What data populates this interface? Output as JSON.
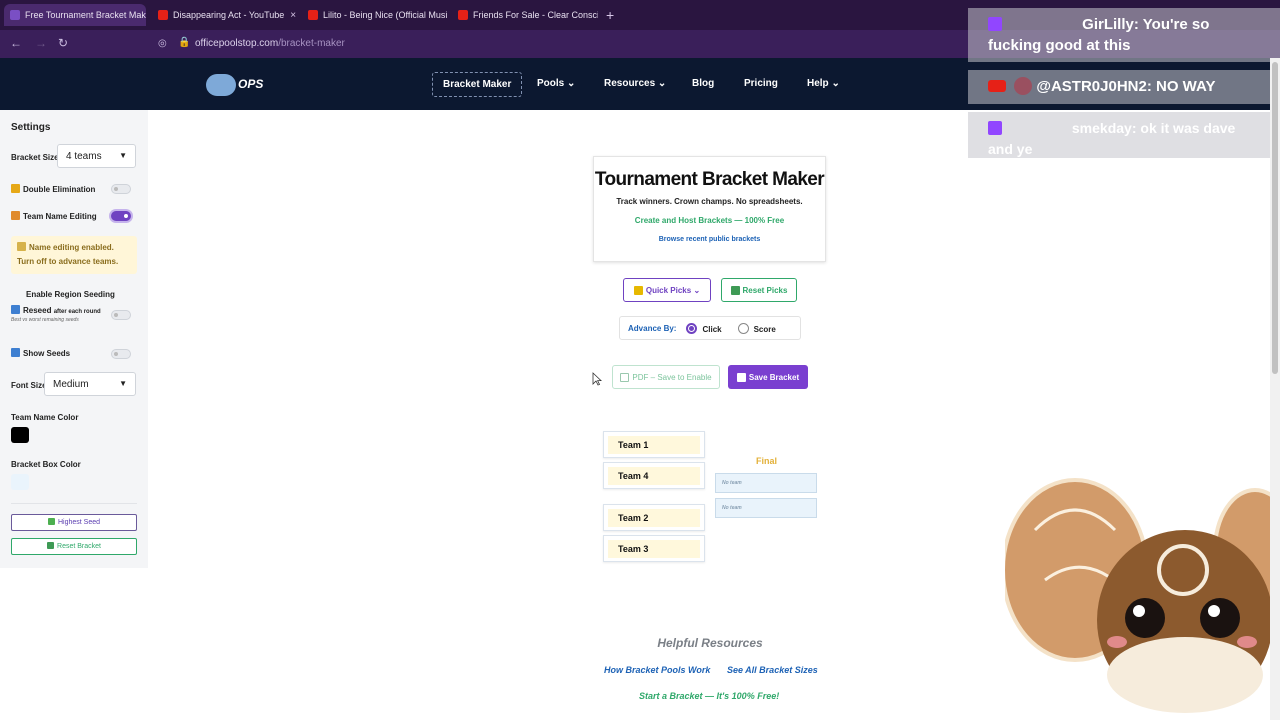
{
  "browser": {
    "tabs": [
      {
        "title": "Free Tournament Bracket Maker",
        "favicon_color": "#7a4fc4"
      },
      {
        "title": "Disappearing Act - YouTube",
        "favicon_color": "#e62117"
      },
      {
        "title": "Lilito - Being Nice (Official Musi",
        "favicon_color": "#e62117"
      },
      {
        "title": "Friends For Sale - Clear Conscie",
        "favicon_color": "#e62117"
      }
    ],
    "close_glyph": "×",
    "new_tab_glyph": "+",
    "url_domain": "officepoolstop.com",
    "url_path": "/bracket-maker"
  },
  "site": {
    "logo_text": "OPS",
    "nav": [
      "Bracket Maker",
      "Pools",
      "Resources",
      "Blog",
      "Pricing",
      "Help"
    ]
  },
  "sidebar": {
    "title": "Settings",
    "bracket_size_label": "Bracket Size",
    "bracket_size_value": "4 teams",
    "double_elim_label": "Double Elimination",
    "team_name_editing_label": "Team Name Editing",
    "notice": "Name editing enabled. Turn off to advance teams.",
    "region_seeding_label": "Enable Region Seeding",
    "reseed_label": "Reseed",
    "reseed_suffix": "after each round",
    "reseed_hint": "Best vs worst remaining seeds",
    "show_seeds_label": "Show Seeds",
    "font_size_label": "Font Size",
    "font_size_value": "Medium",
    "team_name_color_label": "Team Name Color",
    "team_name_color": "#000000",
    "bracket_box_color_label": "Bracket Box Color",
    "bracket_box_color": "#eaf4fc",
    "highest_seed_btn": "Highest Seed",
    "reset_bracket_btn": "Reset Bracket",
    "toggles": {
      "double_elimination": false,
      "team_name_editing": true,
      "reseed": false,
      "show_seeds": false
    }
  },
  "main": {
    "title": "Tournament Bracket Maker",
    "subtitle": "Track winners. Crown champs. No spreadsheets.",
    "free_line": "Create and Host Brackets — 100% Free",
    "browse_link": "Browse recent public brackets",
    "quick_picks": "Quick Picks",
    "reset_picks": "Reset Picks",
    "advance_by_label": "Advance By:",
    "advance_options": [
      "Click",
      "Score"
    ],
    "pdf_btn": "PDF – Save to Enable",
    "save_btn": "Save Bracket",
    "final_label": "Final",
    "teams": [
      "Team 1",
      "Team 4",
      "Team 2",
      "Team 3"
    ],
    "final_slots": [
      "No team",
      "No team"
    ],
    "helpful_title": "Helpful Resources",
    "helpful_links": [
      "How Bracket Pools Work",
      "See All Bracket Sizes"
    ],
    "start_link": "Start a Bracket — It's 100% Free!"
  },
  "chat": [
    {
      "user": "GirLilly",
      "text": "You're so fucking good at this"
    },
    {
      "user": "@ASTR0J0HN2",
      "text": "NO WAY"
    },
    {
      "user": "smekday",
      "text": "ok it was dave and ye"
    }
  ],
  "colors": {
    "accent": "#6f42c1",
    "green": "#2fa86a",
    "link_blue": "#1d62b5",
    "header_bg": "#0c1830"
  }
}
